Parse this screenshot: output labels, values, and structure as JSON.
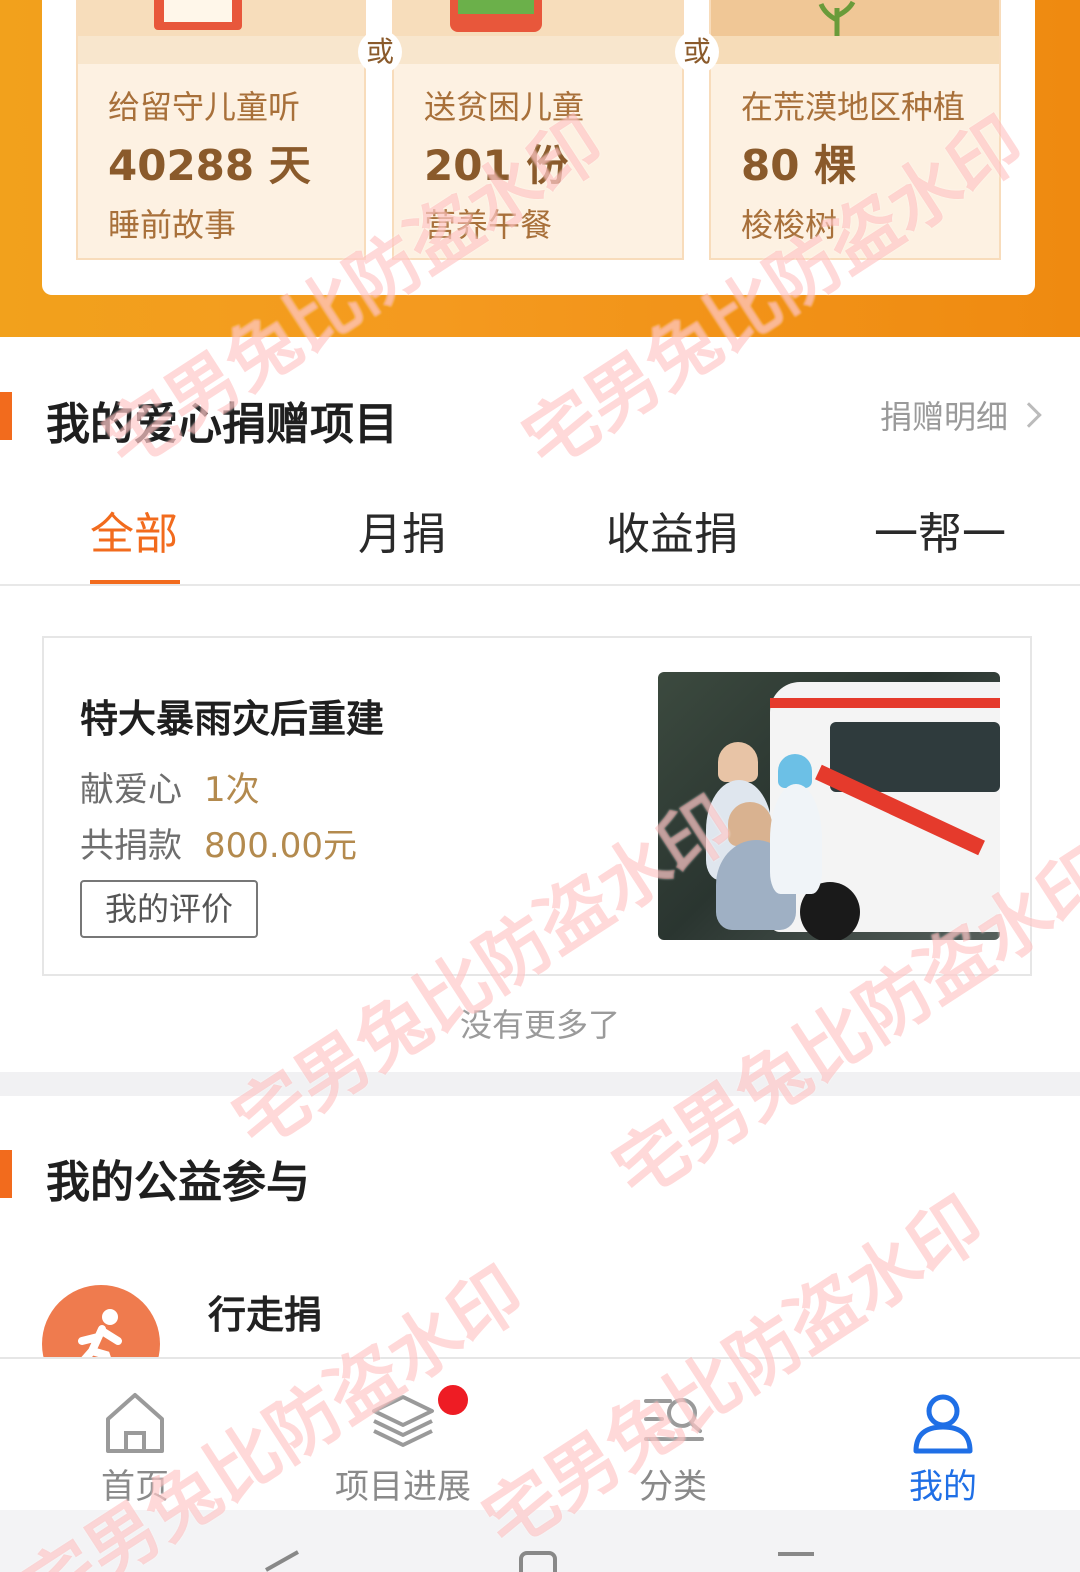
{
  "impact": {
    "or_label": "或",
    "items": [
      {
        "line1": "给留守儿童听",
        "line2": "40288 天",
        "line3": "睡前故事"
      },
      {
        "line1": "送贫困儿童",
        "line2": "201 份",
        "line3": "营养午餐"
      },
      {
        "line1": "在荒漠地区种植",
        "line2": "80 棵",
        "line3": "梭梭树"
      }
    ]
  },
  "donations": {
    "title": "我的爱心捐赠项目",
    "detail_link": "捐赠明细",
    "tabs": [
      {
        "label": "全部",
        "active": true
      },
      {
        "label": "月捐",
        "active": false
      },
      {
        "label": "收益捐",
        "active": false
      },
      {
        "label": "一帮一",
        "active": false
      }
    ],
    "project": {
      "title": "特大暴雨灾后重建",
      "love_label": "献爱心",
      "love_value": "1次",
      "amount_label": "共捐款",
      "amount_value": "800.00元",
      "eval_button": "我的评价"
    },
    "no_more": "没有更多了"
  },
  "participation": {
    "title": "我的公益参与",
    "activity_label": "行走捐"
  },
  "nav": [
    {
      "label": "首页",
      "icon": "home-icon",
      "active": false
    },
    {
      "label": "项目进展",
      "icon": "layers-icon",
      "active": false,
      "badge": true
    },
    {
      "label": "分类",
      "icon": "category-search-icon",
      "active": false
    },
    {
      "label": "我的",
      "icon": "user-icon",
      "active": true
    }
  ],
  "watermark": "宅男兔比防盗水印",
  "colors": {
    "accent": "#f26b1d",
    "nav_active": "#1f6fe6",
    "banner": "#f49a1f",
    "amount": "#b38a4e"
  }
}
